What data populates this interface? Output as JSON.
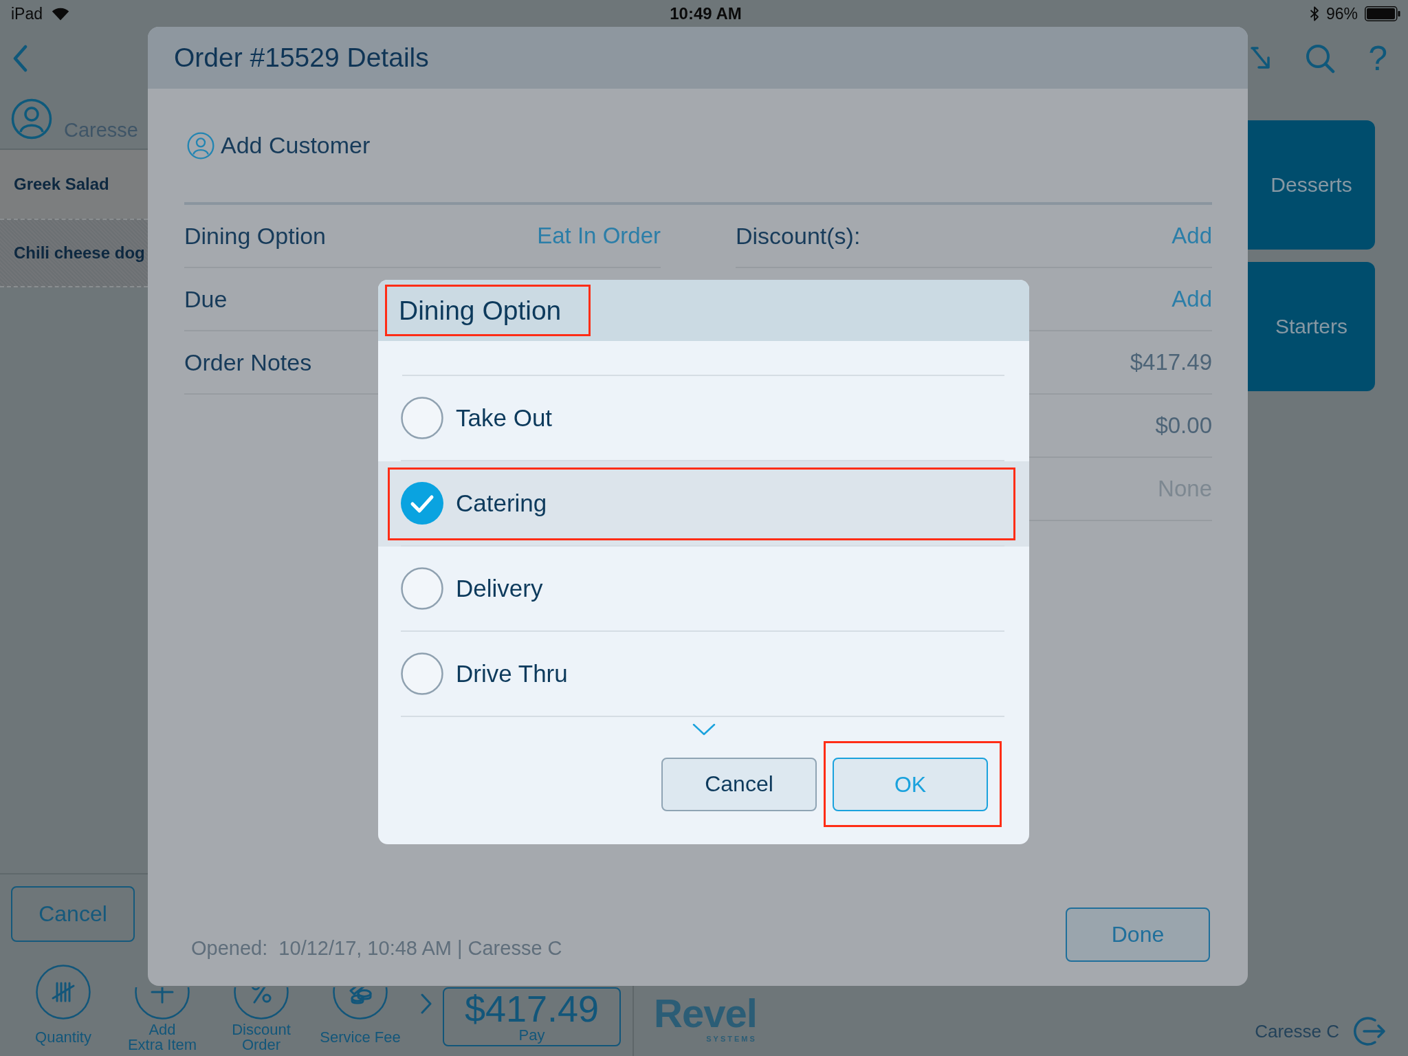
{
  "status_bar": {
    "device": "iPad",
    "time": "10:49 AM",
    "battery": "96%"
  },
  "top_bar": {
    "help": "?"
  },
  "order_panel": {
    "customer": "Caresse",
    "items": [
      {
        "name": "Greek Salad",
        "selected": true
      },
      {
        "name": "Chili cheese dog",
        "selected": false
      }
    ],
    "cancel_button": "Cancel"
  },
  "categories": [
    {
      "label": "Desserts"
    },
    {
      "label": "Starters"
    }
  ],
  "toolbar": {
    "actions": [
      {
        "label": "Quantity",
        "kind": "tally"
      },
      {
        "label": "Add\nExtra Item",
        "kind": "plus"
      },
      {
        "label": "Discount\nOrder",
        "kind": "percent"
      },
      {
        "label": "Service Fee",
        "kind": "coins"
      }
    ],
    "pay": {
      "amount": "$417.49",
      "label": "Pay"
    },
    "logo": {
      "name": "Revel",
      "tagline": "SYSTEMS"
    },
    "user": "Caresse C"
  },
  "order_details": {
    "title": "Order #15529 Details",
    "add_customer": "Add Customer",
    "left_fields": [
      {
        "label": "Dining Option",
        "value": "Eat In Order",
        "kind": "link"
      },
      {
        "label": "Due"
      },
      {
        "label": "Order Notes"
      }
    ],
    "right_fields": [
      {
        "label": "Discount(s):",
        "value": "Add",
        "kind": "link"
      },
      {
        "value": "Add",
        "kind": "link"
      },
      {
        "value": "$417.49",
        "kind": "amount"
      },
      {
        "value": "$0.00",
        "kind": "amount"
      },
      {
        "value": "None",
        "kind": "empty"
      }
    ],
    "opened": "Opened:  10/12/17, 10:48 AM | Caresse C",
    "done_button": "Done"
  },
  "dining_dialog": {
    "title": "Dining Option",
    "title_highlighted": true,
    "options": [
      {
        "label": "Take Out",
        "selected": false,
        "highlighted": false
      },
      {
        "label": "Catering",
        "selected": true,
        "highlighted": true
      },
      {
        "label": "Delivery",
        "selected": false,
        "highlighted": false
      },
      {
        "label": "Drive Thru",
        "selected": false,
        "highlighted": false
      }
    ],
    "buttons": [
      {
        "label": "Cancel",
        "kind": "cancel",
        "highlighted": false
      },
      {
        "label": "OK",
        "kind": "confirm",
        "highlighted": true
      }
    ]
  }
}
